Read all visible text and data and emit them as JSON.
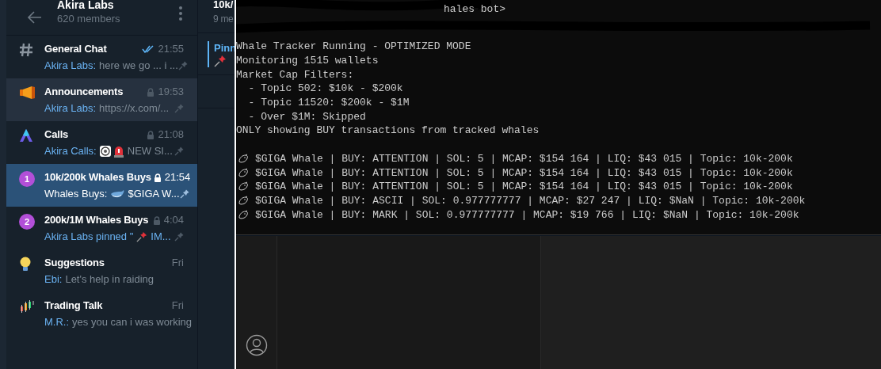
{
  "group": {
    "title": "Akira Labs",
    "subtitle": "620 members"
  },
  "topics": [
    {
      "kind": "hash",
      "name": "General Chat",
      "read": true,
      "locked": false,
      "time": "21:55",
      "sender": "Akira Labs:",
      "preview": [
        {
          "kind": "text",
          "text": "here we go ... i ..."
        }
      ],
      "pinned": true,
      "selected": false,
      "hovered": false
    },
    {
      "kind": "megaphone",
      "name": "Announcements",
      "read": false,
      "locked": true,
      "time": "19:53",
      "sender": "Akira Labs:",
      "preview": [
        {
          "kind": "text",
          "text": "https://x.com/..."
        }
      ],
      "pinned": true,
      "selected": false,
      "hovered": true
    },
    {
      "kind": "logo",
      "name": "Calls",
      "read": false,
      "locked": true,
      "time": "21:08",
      "sender": "Akira Calls:",
      "preview": [
        {
          "kind": "coin"
        },
        {
          "kind": "siren"
        },
        {
          "kind": "text",
          "text": "NEW SI..."
        }
      ],
      "pinned": true,
      "selected": false,
      "hovered": false
    },
    {
      "kind": "badge",
      "badge": "1",
      "name": "10k/200k Whales Buys",
      "read": false,
      "locked": true,
      "time": "21:54",
      "sender": "Whales Buys:",
      "preview": [
        {
          "kind": "whale"
        },
        {
          "kind": "text",
          "text": "$GIGA W..."
        }
      ],
      "pinned": true,
      "selected": true,
      "hovered": false
    },
    {
      "kind": "badge",
      "badge": "2",
      "name": "200k/1M Whales Buys",
      "read": false,
      "locked": true,
      "time": "4:04",
      "sender": "Akira Labs pinned \"",
      "preview": [
        {
          "kind": "pin"
        },
        {
          "kind": "text",
          "text": "IM..."
        }
      ],
      "pinned": true,
      "selected": false,
      "hovered": false
    },
    {
      "kind": "bulb",
      "name": "Suggestions",
      "read": false,
      "locked": false,
      "time": "Fri",
      "sender": "Ebi:",
      "preview": [
        {
          "kind": "text",
          "text": "Let's help in raiding"
        }
      ],
      "pinned": false,
      "selected": false,
      "hovered": false
    },
    {
      "kind": "candles",
      "name": "Trading Talk",
      "read": false,
      "locked": false,
      "time": "Fri",
      "sender": "M.R.:",
      "preview": [
        {
          "kind": "text",
          "text": "yes you can i was working"
        }
      ],
      "pinned": false,
      "selected": false,
      "hovered": false
    }
  ],
  "chat": {
    "title": "10k/",
    "subtitle": "9 me",
    "pinned_label": "Pinn"
  },
  "terminal": {
    "prompt": "hales bot>",
    "lines": [
      {
        "kind": "text",
        "text": "Whale Tracker Running - OPTIMIZED MODE"
      },
      {
        "kind": "text",
        "text": "Monitoring 1515 wallets"
      },
      {
        "kind": "text",
        "text": "Market Cap Filters:"
      },
      {
        "kind": "text",
        "text": "  - Topic 502: $10k - $200k"
      },
      {
        "kind": "text",
        "text": "  - Topic 11520: $200k - $1M"
      },
      {
        "kind": "text",
        "text": "  - Over $1M: Skipped"
      },
      {
        "kind": "text",
        "text": "ONLY showing BUY transactions from tracked whales"
      },
      {
        "kind": "blank"
      },
      {
        "kind": "whale",
        "text": "$GIGA Whale | BUY: ATTENTION | SOL: 5 | MCAP: $154 164 | LIQ: $43 015 | Topic: 10k-200k"
      },
      {
        "kind": "whale",
        "text": "$GIGA Whale | BUY: ATTENTION | SOL: 5 | MCAP: $154 164 | LIQ: $43 015 | Topic: 10k-200k"
      },
      {
        "kind": "whale",
        "text": "$GIGA Whale | BUY: ATTENTION | SOL: 5 | MCAP: $154 164 | LIQ: $43 015 | Topic: 10k-200k"
      },
      {
        "kind": "whale",
        "text": "$GIGA Whale | BUY: ASCII | SOL: 0.977777777 | MCAP: $27 247 | LIQ: $NaN | Topic: 10k-200k"
      },
      {
        "kind": "whale",
        "text": "$GIGA Whale | BUY: MARK | SOL: 0.977777777 | MCAP: $19 766 | LIQ: $NaN | Topic: 10k-200k"
      }
    ]
  }
}
